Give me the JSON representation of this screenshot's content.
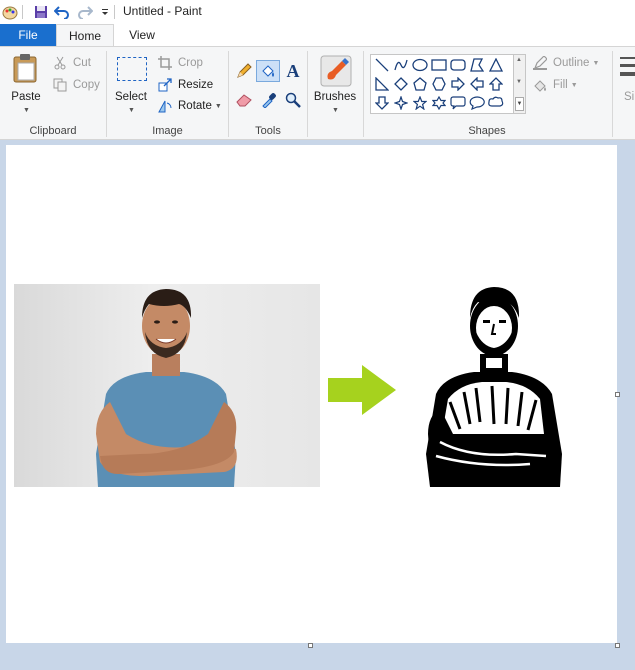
{
  "window": {
    "title": "Untitled - Paint"
  },
  "tabs": {
    "file": "File",
    "home": "Home",
    "view": "View"
  },
  "clipboard": {
    "paste": "Paste",
    "cut": "Cut",
    "copy": "Copy",
    "label": "Clipboard"
  },
  "image": {
    "select": "Select",
    "crop": "Crop",
    "resize": "Resize",
    "rotate": "Rotate",
    "label": "Image"
  },
  "tools": {
    "label": "Tools"
  },
  "brushes": {
    "label": "Brushes"
  },
  "shapes": {
    "label": "Shapes",
    "outline": "Outline",
    "fill": "Fill"
  },
  "colors": {
    "accent": "#1a6fce",
    "arrow": "#a6d21e",
    "shirt": "#5b8fb5",
    "skin": "#c48a66",
    "hair": "#2a1d16"
  },
  "icons": [
    "paint-app-icon",
    "save-icon",
    "undo-icon",
    "redo-icon",
    "customize-icon",
    "paste-icon",
    "cut-icon",
    "copy-icon",
    "select-icon",
    "crop-icon",
    "resize-icon",
    "rotate-icon",
    "pencil-icon",
    "fill-icon",
    "text-icon",
    "eraser-icon",
    "color-picker-icon",
    "magnifier-icon",
    "brushes-icon",
    "outline-icon",
    "fill-shape-icon"
  ]
}
